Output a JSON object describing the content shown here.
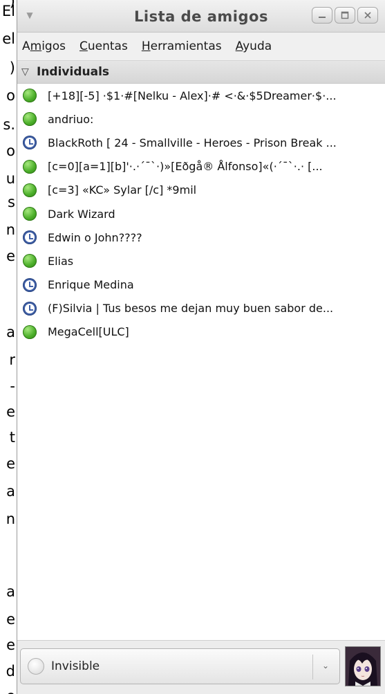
{
  "background_text": [
    ")",
    "El",
    "el",
    ")",
    "o",
    "s.",
    "o",
    "u",
    "s",
    "n",
    "e",
    "a",
    "r",
    "-",
    "e",
    "t",
    "e",
    "a",
    "n",
    "a",
    "e",
    "e",
    "d",
    "e"
  ],
  "window": {
    "title": "Lista de amigos"
  },
  "menubar": {
    "items": [
      {
        "label": "Amigos",
        "mnemonic": "m"
      },
      {
        "label": "Cuentas",
        "mnemonic": "C"
      },
      {
        "label": "Herramientas",
        "mnemonic": "H"
      },
      {
        "label": "Ayuda",
        "mnemonic": "A"
      }
    ]
  },
  "group": {
    "label": "Individuals"
  },
  "contacts": [
    {
      "name": "[+18][-5] ·$1·#[Nelku - Alex]·# <·&·$5Dreamer·$·...",
      "status": "available"
    },
    {
      "name": "andriuo:",
      "status": "available"
    },
    {
      "name": "BlackRoth     [ 24 - Smallville - Heroes - Prison Break ...",
      "status": "away"
    },
    {
      "name": "[c=0][a=1][b]'·.·´¯`·)»[Eðgå® Ålfonso]«(·´¯`·.· [...",
      "status": "available"
    },
    {
      "name": "[c=3] «KC» Sylar [/c] *9mil",
      "status": "available"
    },
    {
      "name": "Dark Wizard",
      "status": "available"
    },
    {
      "name": "Edwin o John????",
      "status": "away"
    },
    {
      "name": "Elias",
      "status": "available"
    },
    {
      "name": "Enrique Medina",
      "status": "away"
    },
    {
      "name": "(F)Silvia   |  Tus besos me dejan muy buen sabor de...",
      "status": "away"
    },
    {
      "name": "MegaCell[ULC]",
      "status": "available"
    }
  ],
  "status_selector": {
    "value": "Invisible"
  },
  "colors": {
    "available": "#4caf2a",
    "away": "#3f5fa6"
  }
}
